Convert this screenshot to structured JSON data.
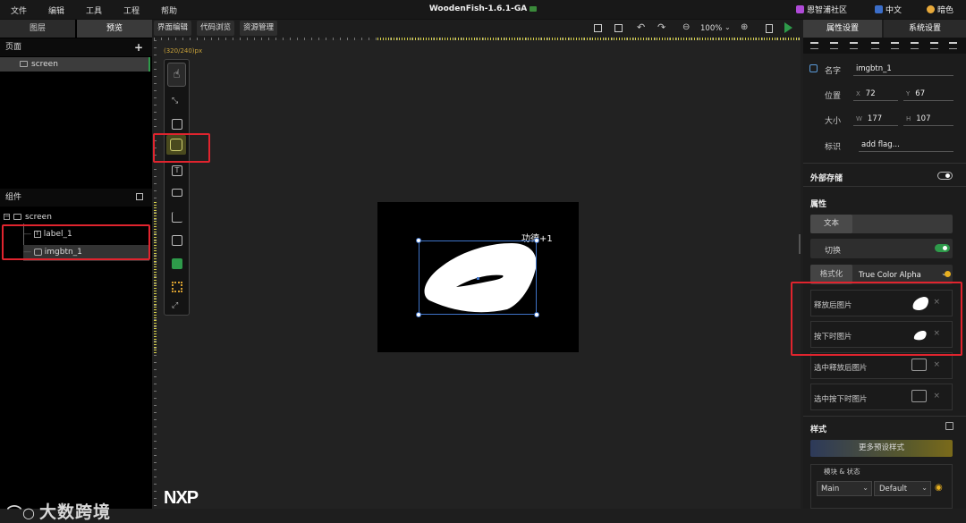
{
  "menu": {
    "items": [
      "文件",
      "编辑",
      "工具",
      "工程",
      "帮助"
    ],
    "title": "WoodenFish-1.6.1-GA",
    "community": "恩智浦社区",
    "language": "中文",
    "theme": "暗色"
  },
  "left_panel": {
    "tabs": [
      "图层",
      "预览"
    ],
    "pages_title": "页面",
    "add_symbol": "+",
    "screen_label": "screen",
    "components_title": "组件",
    "tree": {
      "root": "screen",
      "children": [
        "label_1",
        "imgbtn_1"
      ]
    },
    "watermark": "大数跨境"
  },
  "center": {
    "tabs": [
      "界面编辑",
      "代码浏览",
      "资源管理"
    ],
    "zoom": "100%",
    "resolution": "(320/240)px",
    "label_text": "功德+1",
    "vendor_logo": "NXP"
  },
  "right_panel": {
    "tabs": [
      "属性设置",
      "系统设置"
    ],
    "name_label": "名字",
    "name_value": "imgbtn_1",
    "position_label": "位置",
    "x_value": "72",
    "y_value": "67",
    "size_label": "大小",
    "w_value": "177",
    "h_value": "107",
    "flag_label": "标识",
    "flag_value": "add flag...",
    "external_storage": "外部存储",
    "attributes_title": "属性",
    "text_button": "文本",
    "switch_label": "切换",
    "format_label": "格式化",
    "format_value": "True Color Alpha",
    "images": [
      "释放后图片",
      "按下时图片",
      "选中释放后图片",
      "选中按下时图片"
    ],
    "style_title": "样式",
    "more_styles": "更多预设样式",
    "module_state": "模块 & 状态",
    "part_value": "Main",
    "state_value": "Default"
  },
  "colors": {
    "accent": "#2e9a4a",
    "highlight_red": "#e0242e",
    "selection_blue": "#3f73c8",
    "ruler_yellow": "#d8d24a"
  }
}
